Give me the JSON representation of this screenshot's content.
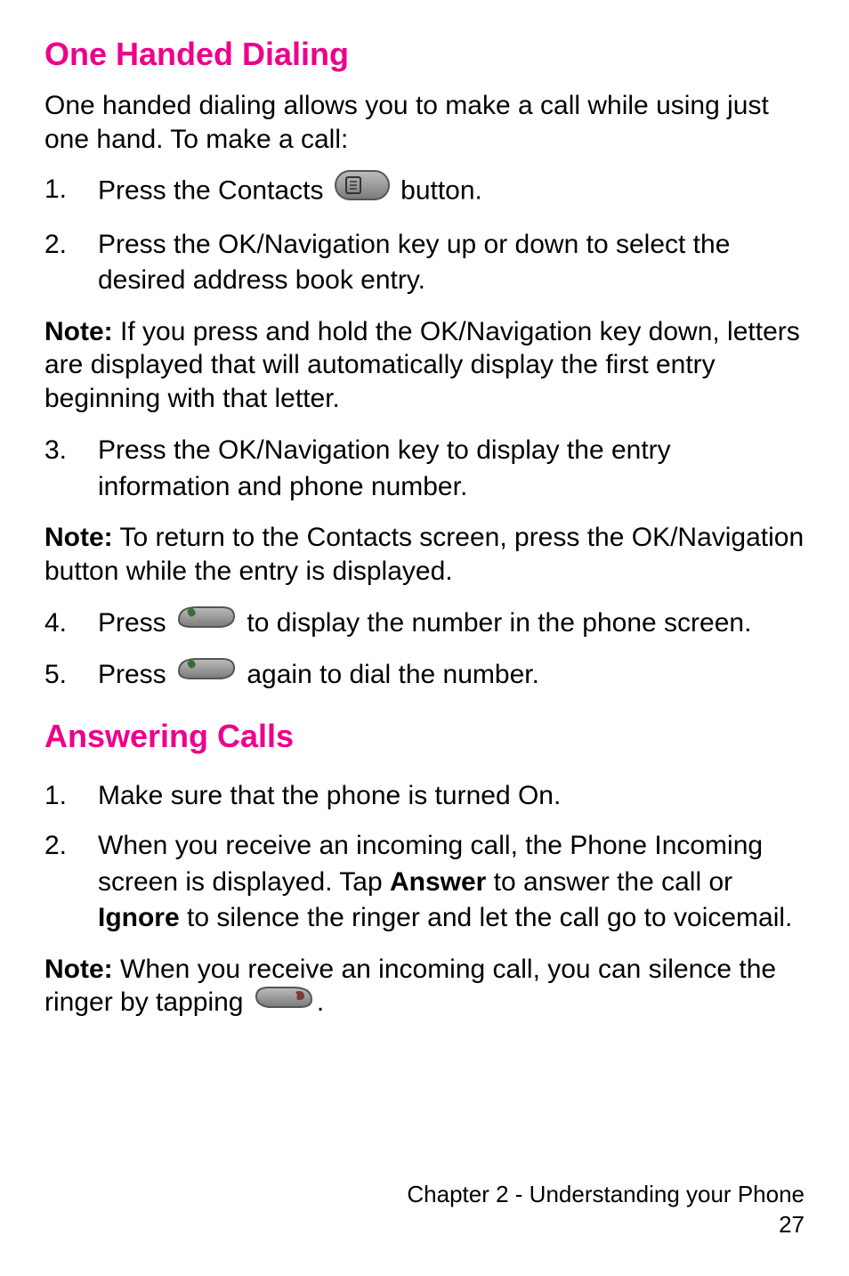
{
  "sections": {
    "oneHanded": {
      "heading": "One Handed Dialing",
      "intro": "One handed dialing allows you to make a call while using just one hand. To make a call:",
      "steps": {
        "s1a": "Press the Contacts ",
        "s1b": " button.",
        "s2": "Press the OK/Navigation key up or down to select the desired address book entry.",
        "s3": "Press the OK/Navigation key to display the entry information and phone number.",
        "s4a": "Press ",
        "s4b": " to display the number in the phone screen.",
        "s5a": "Press ",
        "s5b": " again to dial the number."
      },
      "note1": "If you press and hold the OK/Navigation key down, letters are displayed that will automatically display the first entry beginning with that letter.",
      "note2": "To return to the Contacts screen, press the OK/Navigation button while the entry is displayed."
    },
    "answering": {
      "heading": "Answering Calls",
      "steps": {
        "s1": "Make sure that the phone is turned On.",
        "s2a": "When you receive an incoming call, the Phone Incoming screen is displayed. Tap ",
        "s2_answer": "Answer",
        "s2b": " to answer the call or ",
        "s2_ignore": "Ignore",
        "s2c": " to silence the ringer and let the call go to voicemail."
      },
      "note1a": "When you receive an incoming call, you can silence the ringer by tapping ",
      "note1b": "."
    }
  },
  "noteLabel": "Note:",
  "stepNumbers": {
    "n1": "1.",
    "n2": "2.",
    "n3": "3.",
    "n4": "4.",
    "n5": "5."
  },
  "footer": {
    "chapter": "Chapter 2 - Understanding your Phone",
    "page": "27"
  }
}
